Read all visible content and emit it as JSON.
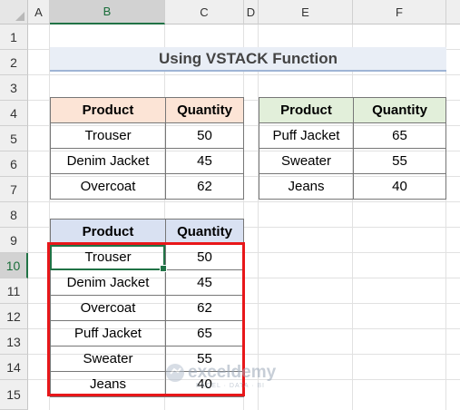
{
  "columns": [
    "A",
    "B",
    "C",
    "D",
    "E",
    "F"
  ],
  "selected_column": "B",
  "rows": [
    "1",
    "2",
    "3",
    "4",
    "5",
    "6",
    "7",
    "8",
    "9",
    "10",
    "11",
    "12",
    "13",
    "14",
    "15"
  ],
  "selected_row": "10",
  "title": "Using VSTACK Function",
  "table1": {
    "headers": [
      "Product",
      "Quantity"
    ],
    "rows": [
      [
        "Trouser",
        "50"
      ],
      [
        "Denim Jacket",
        "45"
      ],
      [
        "Overcoat",
        "62"
      ]
    ]
  },
  "table2": {
    "headers": [
      "Product",
      "Quantity"
    ],
    "rows": [
      [
        "Puff Jacket",
        "65"
      ],
      [
        "Sweater",
        "55"
      ],
      [
        "Jeans",
        "40"
      ]
    ]
  },
  "result": {
    "headers": [
      "Product",
      "Quantity"
    ],
    "rows": [
      [
        "Trouser",
        "50"
      ],
      [
        "Denim Jacket",
        "45"
      ],
      [
        "Overcoat",
        "62"
      ],
      [
        "Puff Jacket",
        "65"
      ],
      [
        "Sweater",
        "55"
      ],
      [
        "Jeans",
        "40"
      ]
    ]
  },
  "watermark": {
    "name": "exceldemy",
    "tagline": "EXCEL · DATA · BI"
  },
  "colors": {
    "highlight": "#e8171a",
    "active": "#217346"
  }
}
